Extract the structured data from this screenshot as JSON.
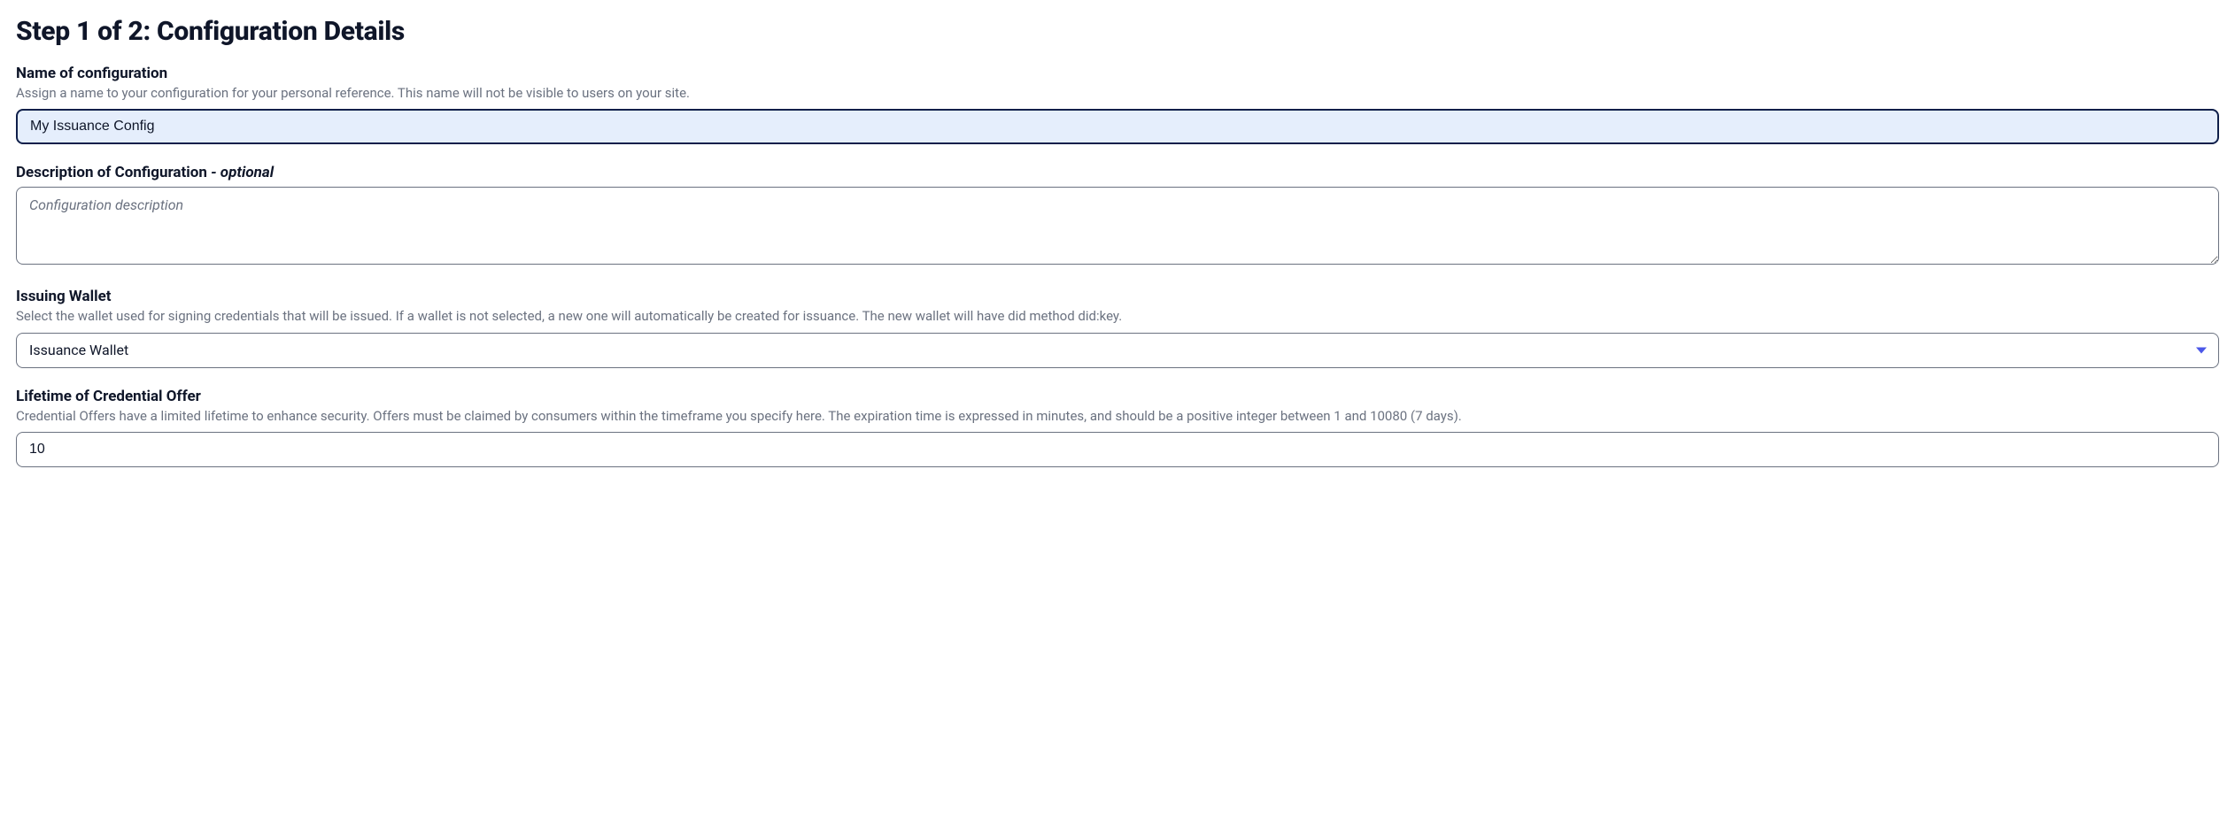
{
  "header": {
    "title": "Step 1 of 2: Configuration Details"
  },
  "fields": {
    "name": {
      "label": "Name of configuration",
      "help": "Assign a name to your configuration for your personal reference. This name will not be visible to users on your site.",
      "value": "My Issuance Config"
    },
    "description": {
      "label": "Description of Configuration ",
      "optional_flag": "- optional",
      "placeholder": "Configuration description",
      "value": ""
    },
    "wallet": {
      "label": "Issuing Wallet",
      "help": "Select the wallet used for signing credentials that will be issued. If a wallet is not selected, a new one will automatically be created for issuance. The new wallet will have did method did:key.",
      "selected": "Issuance Wallet"
    },
    "lifetime": {
      "label": "Lifetime of Credential Offer",
      "help": "Credential Offers have a limited lifetime to enhance security. Offers must be claimed by consumers within the timeframe you specify here. The expiration time is expressed in minutes, and should be a positive integer between 1 and 10080 (7 days).",
      "value": "10"
    }
  }
}
